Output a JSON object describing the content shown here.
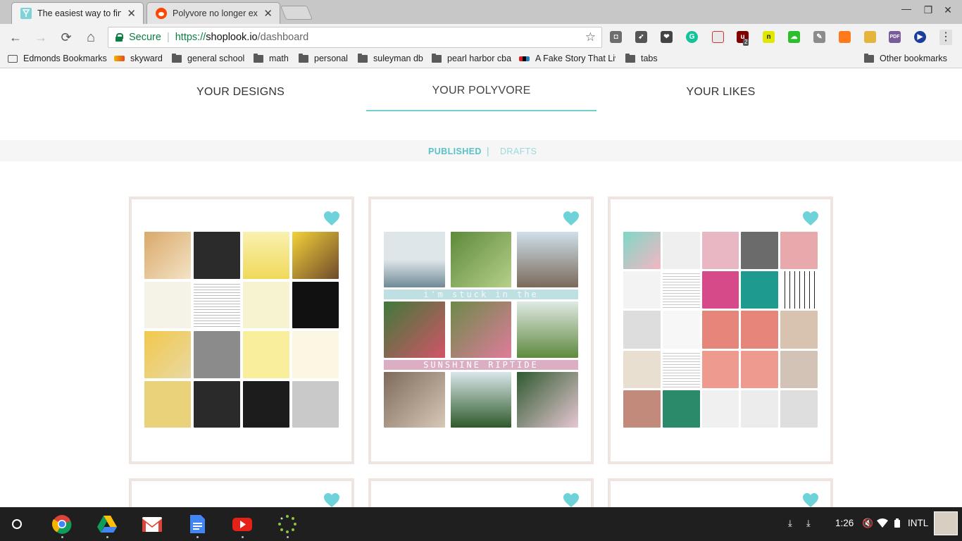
{
  "browser": {
    "tabs": [
      {
        "title": "The easiest way to find t",
        "favicon": "shoplook-icon",
        "active": true
      },
      {
        "title": "Polyvore no longer exist",
        "favicon": "reddit-icon",
        "active": false
      }
    ],
    "close_glyph": "✕",
    "window_controls": {
      "minimize": "—",
      "restore": "❐",
      "close": "✕"
    },
    "nav": {
      "back": "←",
      "forward": "→",
      "reload": "⟳",
      "home": "⌂"
    },
    "omnibox": {
      "secure_label": "Secure",
      "divider": "|",
      "scheme": "https://",
      "host": "shoplook.io",
      "path": "/dashboard"
    },
    "star_glyph": "☆",
    "menu_glyph": "⋮",
    "extensions": [
      {
        "name": "camera-extension-icon",
        "color": "#6d6d6d",
        "label": "◘"
      },
      {
        "name": "rocket-extension-icon",
        "color": "#555555",
        "label": "➶"
      },
      {
        "name": "pocket-extension-icon",
        "color": "#444444",
        "label": "❤"
      },
      {
        "name": "grammarly-extension-icon",
        "color": "#15c39a",
        "label": "G"
      },
      {
        "name": "calendar-extension-icon",
        "color": "#e8e8e8",
        "label": ""
      },
      {
        "name": "ublock-extension-icon",
        "color": "#800000",
        "label": "u"
      },
      {
        "name": "notability-extension-icon",
        "color": "#e0e800",
        "label": "n"
      },
      {
        "name": "cloud-extension-icon",
        "color": "#2cbf2c",
        "label": "☁"
      },
      {
        "name": "pen-extension-icon",
        "color": "#8c8c8c",
        "label": "✎"
      },
      {
        "name": "highlighter-extension-icon",
        "color": "#ff7a1a",
        "label": ""
      },
      {
        "name": "colorbars-extension-icon",
        "color": "#e3b53d",
        "label": ""
      },
      {
        "name": "pdf-extension-icon",
        "color": "#7a5c9c",
        "label": "PDF"
      },
      {
        "name": "play-extension-icon",
        "color": "#1a3e9c",
        "label": "▶"
      }
    ],
    "ublock_badge": "2",
    "bookmarks": [
      {
        "label": "Edmonds Bookmarks",
        "icon": "apps-icon"
      },
      {
        "label": "skyward",
        "icon": "skyward-icon"
      },
      {
        "label": "general school",
        "icon": "folder-icon"
      },
      {
        "label": "math",
        "icon": "folder-icon"
      },
      {
        "label": "personal",
        "icon": "folder-icon"
      },
      {
        "label": "suleyman db",
        "icon": "folder-icon"
      },
      {
        "label": "pearl harbor cba",
        "icon": "folder-icon"
      },
      {
        "label": "A Fake Story That Liv",
        "icon": "npr-icon"
      },
      {
        "label": "tabs",
        "icon": "folder-icon"
      }
    ],
    "other_bookmarks": "Other bookmarks"
  },
  "page": {
    "main_tabs": [
      {
        "label": "YOUR DESIGNS",
        "active": false
      },
      {
        "label": "YOUR POLYVORE",
        "active": true
      },
      {
        "label": "YOUR LIKES",
        "active": false
      }
    ],
    "sub_tabs": {
      "published": "PUBLISHED",
      "divider": "|",
      "drafts": "DRAFTS"
    },
    "accent_color": "#71cfd4",
    "collage_text": {
      "card2_band1": "i'm stuck in the",
      "card2_band2": "SUNSHINE RIPTIDE"
    }
  },
  "shelf": {
    "time": "1:26",
    "locale": "INTL",
    "apps": [
      "chrome-icon",
      "drive-icon",
      "gmail-icon",
      "docs-icon",
      "youtube-icon",
      "loading-icon"
    ],
    "tray_icons": [
      "download-icon",
      "download-icon",
      "mute-icon",
      "wifi-icon",
      "battery-icon"
    ]
  }
}
